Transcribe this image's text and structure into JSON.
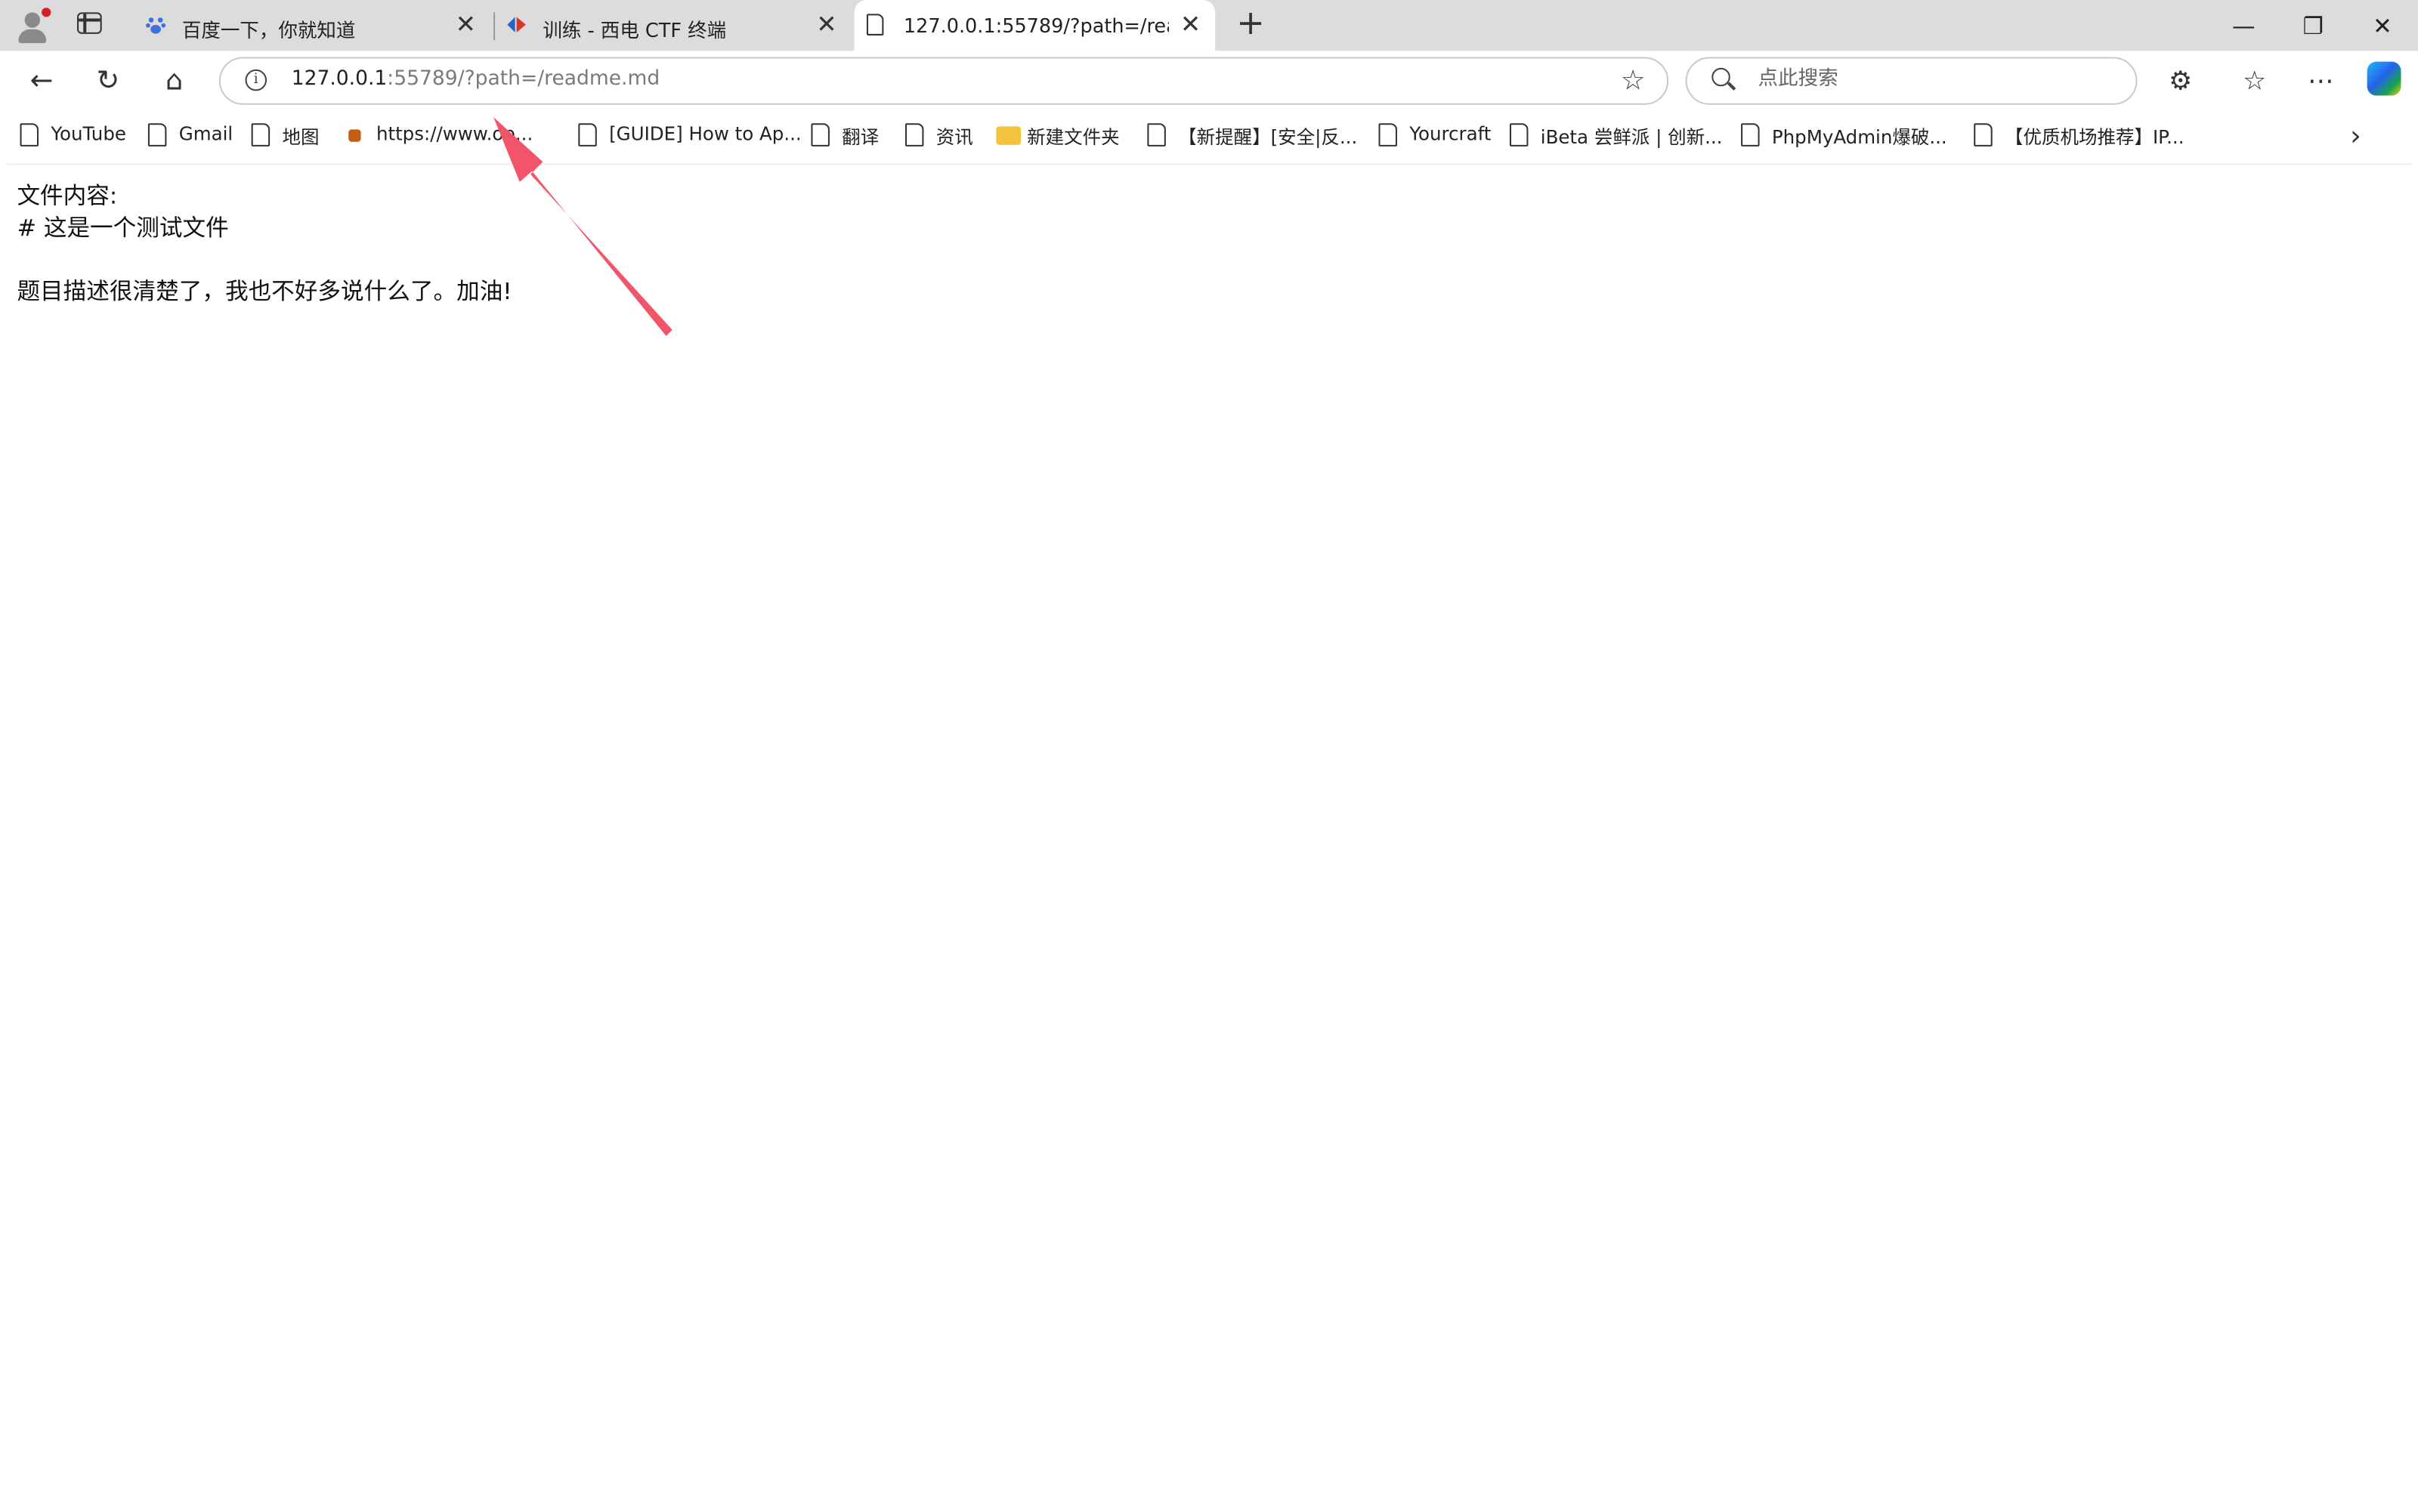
{
  "tabs": [
    {
      "title": "百度一下，你就知道",
      "favicon": "baidu-paw-icon",
      "active": false
    },
    {
      "title": "训练 - 西电 CTF 终端",
      "favicon": "ctf-site-icon",
      "active": false
    },
    {
      "title": "127.0.0.1:55789/?path=/readme.md",
      "favicon": "document-icon",
      "active": true
    }
  ],
  "window_controls": {
    "minimize": "—",
    "restore": "❐",
    "close": "✕"
  },
  "address_bar": {
    "host": "127.0.0.1",
    "rest": ":55789/?path=/readme.md"
  },
  "search_box": {
    "placeholder": "点此搜索"
  },
  "bookmarks": [
    {
      "label": "YouTube",
      "icon": "document-icon"
    },
    {
      "label": "Gmail",
      "icon": "document-icon"
    },
    {
      "label": "地图",
      "icon": "document-icon"
    },
    {
      "label": "https://www.op...",
      "icon": "site-icon"
    },
    {
      "label": "[GUIDE] How to Ap...",
      "icon": "document-icon"
    },
    {
      "label": "翻译",
      "icon": "document-icon"
    },
    {
      "label": "资讯",
      "icon": "document-icon"
    },
    {
      "label": "新建文件夹",
      "icon": "folder-icon"
    },
    {
      "label": "【新提醒】[安全|反...",
      "icon": "document-icon"
    },
    {
      "label": "Yourcraft",
      "icon": "document-icon"
    },
    {
      "label": "iBeta 尝鲜派 | 创新...",
      "icon": "document-icon"
    },
    {
      "label": "PhpMyAdmin爆破...",
      "icon": "document-icon"
    },
    {
      "label": "【优质机场推荐】IP...",
      "icon": "document-icon"
    }
  ],
  "page": {
    "line1": "文件内容:",
    "line2": "# 这是一个测试文件",
    "line3": "题目描述很清楚了，我也不好多说什么了。加油!"
  },
  "annotation": {
    "color": "#f2546a"
  }
}
